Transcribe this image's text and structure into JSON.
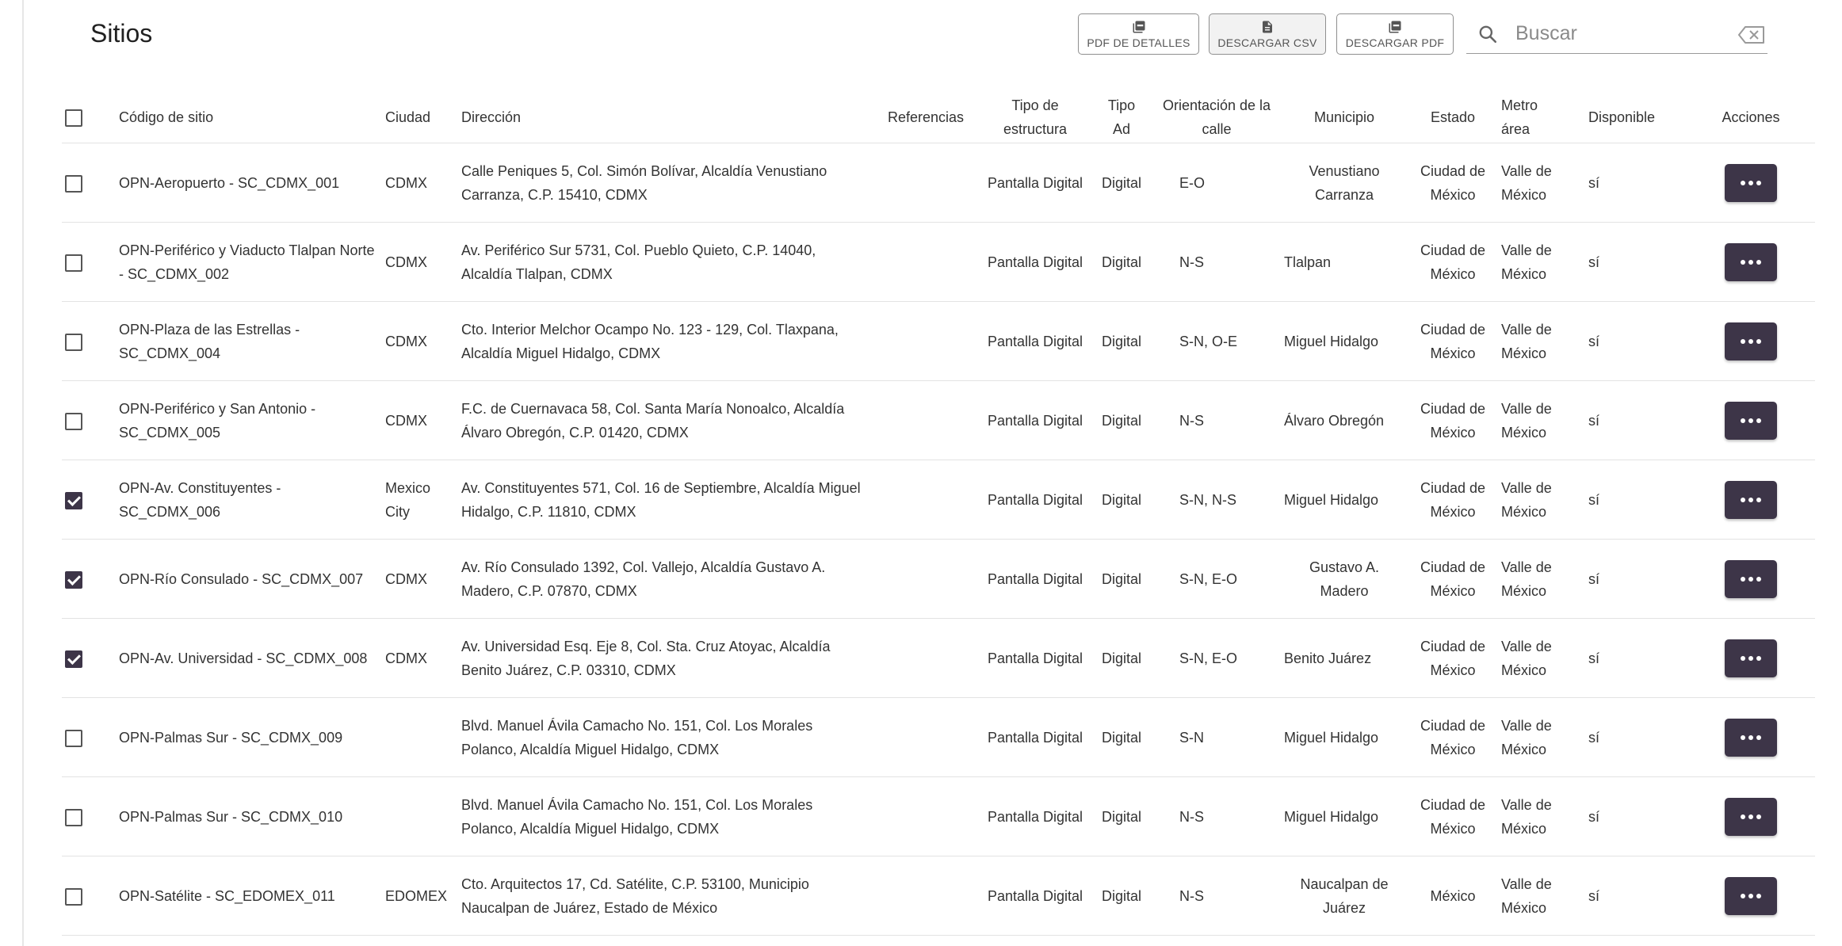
{
  "page": {
    "title": "Sitios"
  },
  "toolbar": {
    "pdf_details_label": "PDF de detalles",
    "csv_label": "Descargar CSV",
    "pdf_label": "Descargar PDF",
    "icons": {
      "pdf": "pdf-file-icon",
      "csv": "document-icon"
    }
  },
  "search": {
    "placeholder": "Buscar",
    "value": "",
    "icon": "search-icon",
    "clear_icon": "backspace-icon"
  },
  "table": {
    "headers": {
      "code": "Código de sitio",
      "city": "Ciudad",
      "address": "Dirección",
      "references": "Referencias",
      "structure_line1": "Tipo de",
      "structure_line2": "estructura",
      "adtype_line1": "Tipo",
      "adtype_line2": "Ad",
      "orientation_line1": "Orientación de la",
      "orientation_line2": "calle",
      "municipality": "Municipio",
      "state": "Estado",
      "metro_line1": "Metro",
      "metro_line2": "área",
      "available": "Disponible",
      "actions": "Acciones"
    },
    "rows": [
      {
        "checked": false,
        "code": "OPN-Aeropuerto - SC_CDMX_001",
        "city": "CDMX",
        "address": "Calle Peniques 5, Col. Simón Bolívar, Alcaldía Venustiano Carranza, C.P. 15410, CDMX",
        "references": "",
        "structure": "Pantalla Digital",
        "ad_type": "Digital",
        "orientation": "E-O",
        "municipality": "Venustiano Carranza",
        "municipality_align": "center",
        "state": "Ciudad de México",
        "metro": "Valle de México",
        "available": "sí"
      },
      {
        "checked": false,
        "code": "OPN-Periférico y Viaducto Tlalpan Norte - SC_CDMX_002",
        "city": "CDMX",
        "address": "Av. Periférico Sur 5731, Col. Pueblo Quieto, C.P. 14040, Alcaldía Tlalpan, CDMX",
        "references": "",
        "structure": "Pantalla Digital",
        "ad_type": "Digital",
        "orientation": "N-S",
        "municipality": "Tlalpan",
        "municipality_align": "left",
        "state": "Ciudad de México",
        "metro": "Valle de México",
        "available": "sí"
      },
      {
        "checked": false,
        "code": "OPN-Plaza de las Estrellas - SC_CDMX_004",
        "city": "CDMX",
        "address": "Cto. Interior Melchor Ocampo No. 123 - 129, Col. Tlaxpana, Alcaldía Miguel Hidalgo, CDMX",
        "references": "",
        "structure": "Pantalla Digital",
        "ad_type": "Digital",
        "orientation": "S-N, O-E",
        "municipality": "Miguel Hidalgo",
        "municipality_align": "left",
        "state": "Ciudad de México",
        "metro": "Valle de México",
        "available": "sí"
      },
      {
        "checked": false,
        "code": "OPN-Periférico y San Antonio - SC_CDMX_005",
        "city": "CDMX",
        "address": "F.C. de Cuernavaca 58, Col. Santa María Nonoalco, Alcaldía Álvaro Obregón, C.P. 01420, CDMX",
        "references": "",
        "structure": "Pantalla Digital",
        "ad_type": "Digital",
        "orientation": "N-S",
        "municipality": "Álvaro Obregón",
        "municipality_align": "left",
        "state": "Ciudad de México",
        "metro": "Valle de México",
        "available": "sí"
      },
      {
        "checked": true,
        "code": "OPN-Av. Constituyentes - SC_CDMX_006",
        "city": "Mexico City",
        "address": "Av. Constituyentes 571, Col. 16 de Septiembre, Alcaldía Miguel Hidalgo, C.P. 11810, CDMX",
        "references": "",
        "structure": "Pantalla Digital",
        "ad_type": "Digital",
        "orientation": "S-N, N-S",
        "municipality": "Miguel Hidalgo",
        "municipality_align": "left",
        "state": "Ciudad de México",
        "metro": "Valle de México",
        "available": "sí"
      },
      {
        "checked": true,
        "code": "OPN-Río Consulado - SC_CDMX_007",
        "city": "CDMX",
        "address": "Av. Río Consulado 1392, Col. Vallejo, Alcaldía Gustavo A. Madero, C.P. 07870, CDMX",
        "references": "",
        "structure": "Pantalla Digital",
        "ad_type": "Digital",
        "orientation": "S-N, E-O",
        "municipality": "Gustavo A. Madero",
        "municipality_align": "center",
        "state": "Ciudad de México",
        "metro": "Valle de México",
        "available": "sí"
      },
      {
        "checked": true,
        "code": "OPN-Av. Universidad - SC_CDMX_008",
        "city": "CDMX",
        "address": "Av. Universidad Esq. Eje 8, Col. Sta. Cruz Atoyac, Alcaldía Benito Juárez, C.P. 03310, CDMX",
        "references": "",
        "structure": "Pantalla Digital",
        "ad_type": "Digital",
        "orientation": "S-N, E-O",
        "municipality": "Benito Juárez",
        "municipality_align": "left",
        "state": "Ciudad de México",
        "metro": "Valle de México",
        "available": "sí"
      },
      {
        "checked": false,
        "code": "OPN-Palmas Sur - SC_CDMX_009",
        "city": "",
        "address": "Blvd. Manuel Ávila Camacho No. 151, Col. Los Morales Polanco, Alcaldía Miguel Hidalgo, CDMX",
        "references": "",
        "structure": "Pantalla Digital",
        "ad_type": "Digital",
        "orientation": "S-N",
        "municipality": "Miguel Hidalgo",
        "municipality_align": "left",
        "state": "Ciudad de México",
        "metro": "Valle de México",
        "available": "sí"
      },
      {
        "checked": false,
        "code": "OPN-Palmas Sur - SC_CDMX_010",
        "city": "",
        "address": "Blvd. Manuel Ávila Camacho No. 151, Col. Los Morales Polanco, Alcaldía Miguel Hidalgo, CDMX",
        "references": "",
        "structure": "Pantalla Digital",
        "ad_type": "Digital",
        "orientation": "N-S",
        "municipality": "Miguel Hidalgo",
        "municipality_align": "left",
        "state": "Ciudad de México",
        "metro": "Valle de México",
        "available": "sí"
      },
      {
        "checked": false,
        "code": "OPN-Satélite - SC_EDOMEX_011",
        "city": "EDOMEX",
        "address": "Cto. Arquitectos 17, Cd. Satélite, C.P. 53100, Municipio Naucalpan de Juárez, Estado de México",
        "references": "",
        "structure": "Pantalla Digital",
        "ad_type": "Digital",
        "orientation": "N-S",
        "municipality": "Naucalpan de Juárez",
        "municipality_align": "center",
        "state": "México",
        "metro": "Valle de México",
        "available": "sí"
      }
    ],
    "row_action_icon": "more-horizontal-icon"
  },
  "colors": {
    "accent": "#3d3548",
    "border": "#e3e3e3"
  }
}
